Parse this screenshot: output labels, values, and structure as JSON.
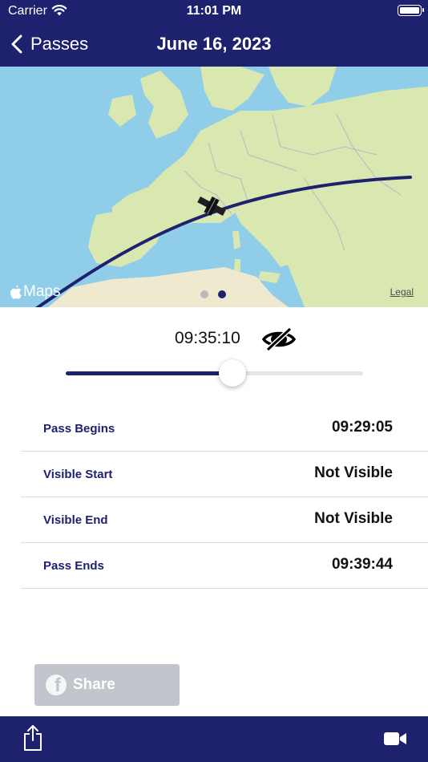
{
  "status_bar": {
    "carrier": "Carrier",
    "time": "11:01 PM"
  },
  "nav": {
    "back_label": "Passes",
    "title": "June 16, 2023"
  },
  "map": {
    "attribution": "Maps",
    "legal": "Legal",
    "page_count": 2,
    "active_page": 2
  },
  "scrubber": {
    "time": "09:35:10",
    "visibility_icon": "eye-slash-icon",
    "progress": 0.56
  },
  "details": [
    {
      "label": "Pass Begins",
      "value": "09:29:05"
    },
    {
      "label": "Visible Start",
      "value": "Not Visible"
    },
    {
      "label": "Visible End",
      "value": "Not Visible"
    },
    {
      "label": "Pass Ends",
      "value": "09:39:44"
    }
  ],
  "share_button": {
    "label": "Share",
    "icon": "facebook-icon"
  },
  "toolbar": {
    "left_icon": "share-icon",
    "right_icon": "video-camera-icon"
  },
  "colors": {
    "brand": "#1e216e",
    "sea": "#8fcde8",
    "land": "#d9e8b0",
    "share_disabled": "#c2c5cb"
  }
}
